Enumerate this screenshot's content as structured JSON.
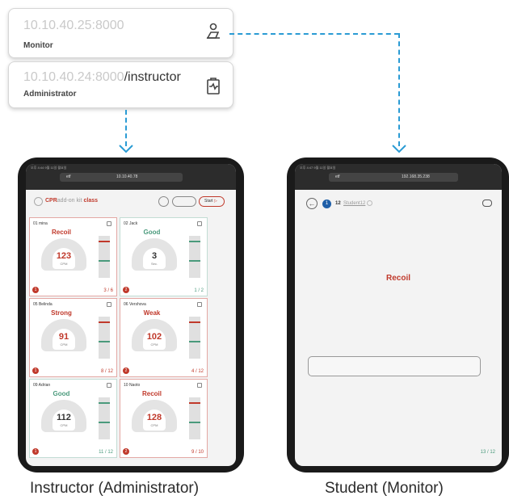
{
  "monitor_card": {
    "address": "10.10.40.25:8000",
    "role": "Monitor",
    "icon": "person-desk-icon"
  },
  "admin_card": {
    "address": "10.10.40.24:8000",
    "path": "/instructor",
    "role": "Administrator",
    "icon": "clipboard-pulse-icon"
  },
  "connector_color": "#2a9bd4",
  "instructor_screen": {
    "status": "오후 4:44  9월 11일 월요일",
    "url_tab": "etf",
    "url": "10.10.40.78",
    "brand": "CPR",
    "brand_sub": "add-on kit",
    "brand_class": "class",
    "start_label": "Start",
    "tiles": [
      {
        "name": "01 mina",
        "state": "Recoil",
        "value": "123",
        "unit": "CPM",
        "badge": "1",
        "count": "3 / 6",
        "tone": "red"
      },
      {
        "name": "02 Jack",
        "state": "Good",
        "value": "3",
        "unit": "Sec.",
        "badge": "2",
        "count": "1 / 2",
        "tone": "green"
      },
      {
        "name": "05 Belinda",
        "state": "Strong",
        "value": "91",
        "unit": "CPM",
        "badge": "1",
        "count": "8 / 12",
        "tone": "red"
      },
      {
        "name": "06 Vershova",
        "state": "Weak",
        "value": "102",
        "unit": "CPM",
        "badge": "2",
        "count": "4 / 12",
        "tone": "red"
      },
      {
        "name": "09 Adrian",
        "state": "Good",
        "value": "112",
        "unit": "CPM",
        "badge": "1",
        "count": "11 / 12",
        "tone": "green"
      },
      {
        "name": "10 Naoto",
        "state": "Recoil",
        "value": "128",
        "unit": "CPM",
        "badge": "2",
        "count": "9 / 10",
        "tone": "red"
      }
    ]
  },
  "student_screen": {
    "status": "오후 4:47  9월 11일 월요일",
    "url_tab": "etf",
    "url": "192.168.35.238",
    "step": "1",
    "student_no": "12",
    "student_name": "Student12",
    "message": "Recoil",
    "count": "13 / 12"
  },
  "captions": {
    "instructor": "Instructor (Administrator)",
    "student": "Student (Monitor)"
  },
  "colors": {
    "red": "#c0392b",
    "green": "#4a9a7c",
    "blue": "#1f5fa8"
  }
}
